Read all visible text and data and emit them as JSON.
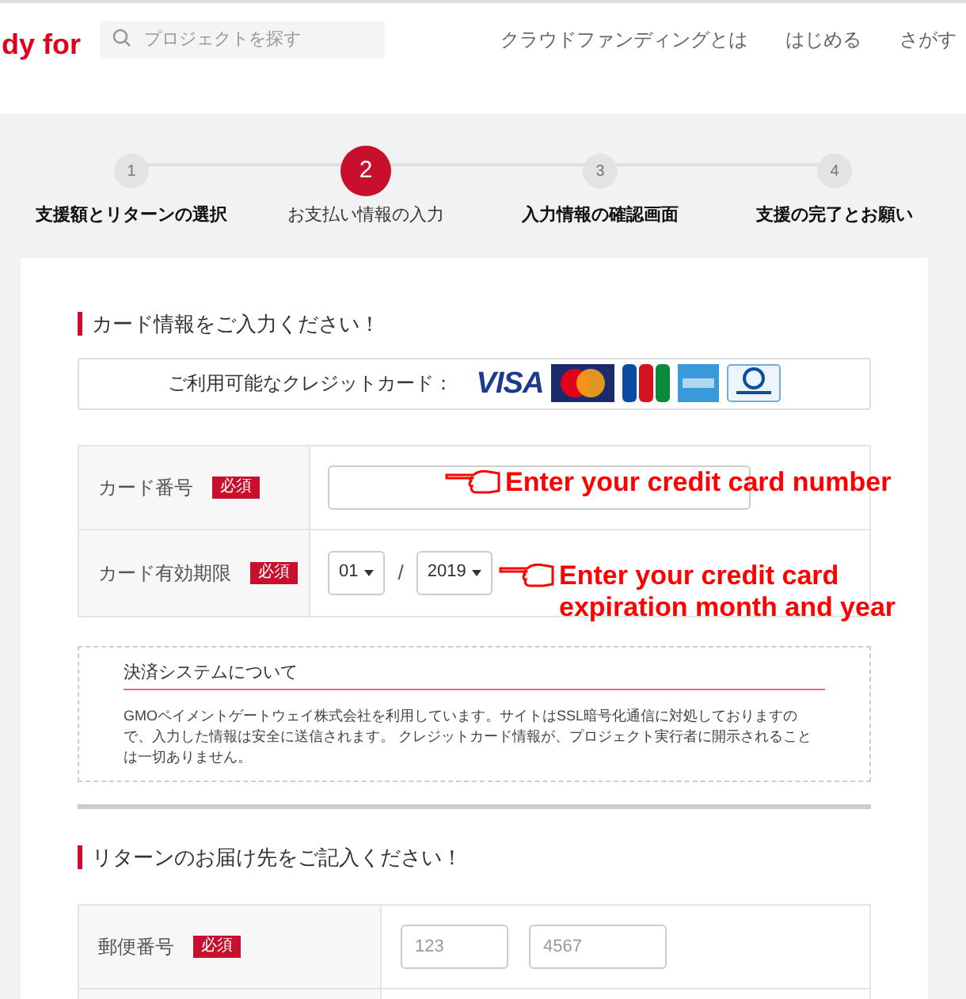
{
  "header": {
    "logo": "dy for",
    "search": {
      "placeholder": "プロジェクトを探す"
    },
    "nav": [
      "クラウドファンディングとは",
      "はじめる",
      "さがす"
    ]
  },
  "steps": [
    {
      "number": "1",
      "label": "支援額とリターンの選択",
      "selected": false
    },
    {
      "number": "2",
      "label": "お支払い情報の入力",
      "selected": true
    },
    {
      "number": "3",
      "label": "入力情報の確認画面",
      "selected": false
    },
    {
      "number": "4",
      "label": "支援の完了とお願い",
      "selected": false
    }
  ],
  "card_section": {
    "title": "カード情報をご入力ください！",
    "accepted_label": "ご利用可能なクレジットカード：",
    "brands": [
      {
        "kind": "visa",
        "text": "VISA"
      },
      {
        "kind": "mastercard"
      },
      {
        "kind": "jcb"
      },
      {
        "kind": "amex"
      },
      {
        "kind": "diners"
      }
    ],
    "fields": [
      {
        "kind": "text",
        "label": "カード番号",
        "badge": "必須"
      },
      {
        "kind": "expiry",
        "label": "カード有効期限",
        "badge": "必須",
        "month": "01",
        "separator": "/",
        "year": "2019"
      }
    ],
    "annotations": [
      {
        "text": "Enter your credit card number"
      },
      {
        "text": "Enter your credit card\nexpiration month and year"
      }
    ],
    "notice": {
      "title": "決済システムについて",
      "body": "GMOペイメントゲートウェイ株式会社を利用しています。サイトはSSL暗号化通信に対処しておりますので、入力した情報は安全に送信されます。 クレジットカード情報が、プロジェクト実行者に開示されることは一切ありません。"
    }
  },
  "return_section": {
    "title": "リターンのお届け先をご記入ください！",
    "fields": [
      {
        "kind": "postal",
        "label": "郵便番号",
        "badge": "必須",
        "placeholders": [
          "123",
          "4567"
        ]
      }
    ]
  }
}
